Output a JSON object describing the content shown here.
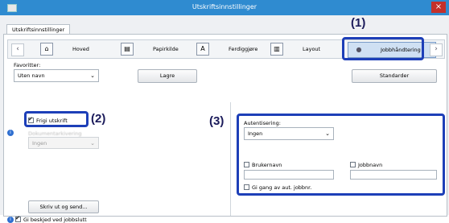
{
  "window": {
    "title": "Utskriftsinnstillinger",
    "close_glyph": "×"
  },
  "tab_header": "Utskriftsinnstillinger",
  "nav": {
    "left_arrow": "‹",
    "right_arrow": "›",
    "tabs": [
      {
        "label": "Hoved",
        "icon": "home-icon",
        "glyph": "⌂"
      },
      {
        "label": "Papirkilde",
        "icon": "paper-tray-icon",
        "glyph": "▤"
      },
      {
        "label": "Ferdiggjøre",
        "icon": "finishing-icon",
        "glyph": "A"
      },
      {
        "label": "Layout",
        "icon": "layout-icon",
        "glyph": "▥"
      },
      {
        "label": "Jobbhåndtering",
        "icon": "job-handling-icon",
        "glyph": "●"
      }
    ]
  },
  "favorites": {
    "label": "Favoritter:",
    "value": "Uten navn",
    "save_label": "Lagre",
    "defaults_label": "Standarder"
  },
  "release_print": {
    "label": "Frigi utskrift",
    "checked": true
  },
  "blurred_label": "Dokumentarkivering",
  "disabled_select": {
    "value": "Ingen"
  },
  "authentication": {
    "label": "Autentisering:",
    "value": "Ingen",
    "username_label": "Brukernavn",
    "jobname_label": "Jobbnavn",
    "auto_jobname_label": "Gi gang av aut. jobbnr."
  },
  "print_send_label": "Skriv ut og send...",
  "notify_label": "Gi beskjed ved jobbslutt",
  "callouts": {
    "one": "(1)",
    "two": "(2)",
    "three": "(3)"
  },
  "colors": {
    "titlebar": "#2f8bd0",
    "highlight": "#1d3fb8",
    "close": "#c4302b"
  }
}
